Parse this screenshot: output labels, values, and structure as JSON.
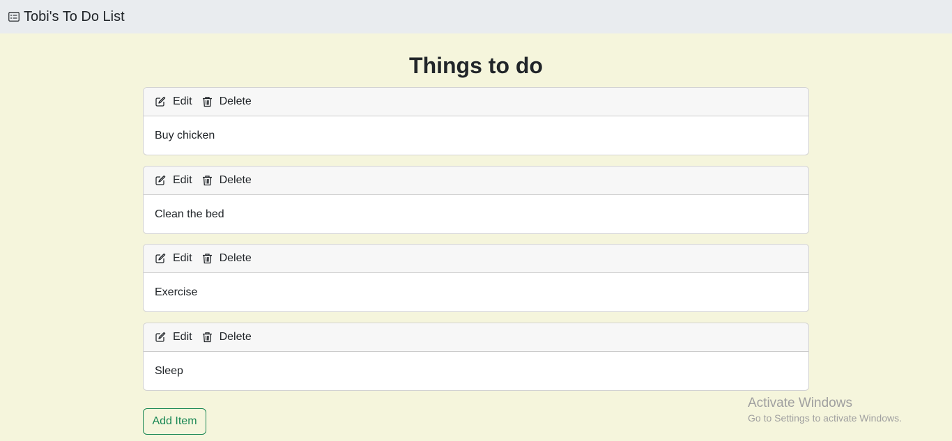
{
  "navbar": {
    "brand": "Tobi's To Do List"
  },
  "page": {
    "title": "Things to do"
  },
  "actions": {
    "edit_label": "Edit",
    "delete_label": "Delete"
  },
  "items": [
    {
      "text": "Buy chicken"
    },
    {
      "text": "Clean the bed"
    },
    {
      "text": "Exercise"
    },
    {
      "text": "Sleep"
    }
  ],
  "add_button": {
    "label": "Add Item"
  },
  "watermark": {
    "title": "Activate Windows",
    "subtitle": "Go to Settings to activate Windows."
  },
  "colors": {
    "background": "#f5f5dc",
    "navbar": "#e9ecef",
    "success": "#198754",
    "card_header": "#f7f7f7"
  },
  "icons": {
    "brand": "card-list-icon",
    "edit": "pencil-square-icon",
    "delete": "trash-icon"
  }
}
